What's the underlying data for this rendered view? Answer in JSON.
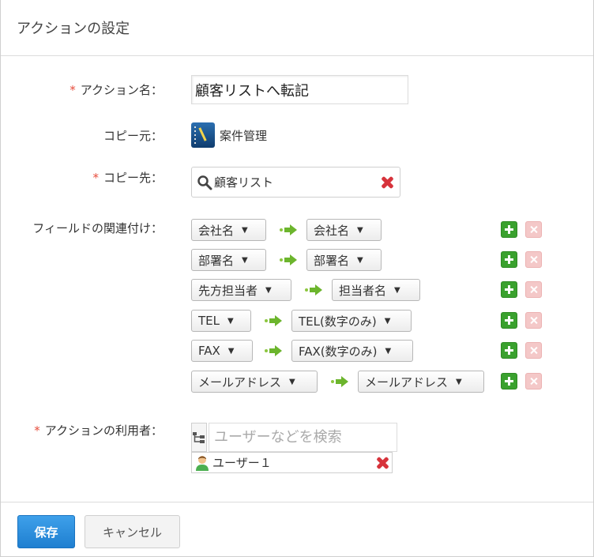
{
  "dialog": {
    "title": "アクションの設定"
  },
  "form": {
    "action_name": {
      "label": "アクション名：",
      "required_mark": "*",
      "value": "顧客リストへ転記"
    },
    "source": {
      "label": "コピー元：",
      "app_name": "案件管理",
      "app_icon": "notebook-app-icon"
    },
    "destination": {
      "label": "コピー先：",
      "required_mark": "*",
      "app_name": "顧客リスト"
    },
    "field_mapping": {
      "label": "フィールドの関連付け：",
      "rows": [
        {
          "from": "会社名",
          "to": "会社名"
        },
        {
          "from": "部署名",
          "to": "部署名"
        },
        {
          "from": "先方担当者",
          "to": "担当者名"
        },
        {
          "from": "TEL",
          "to": "TEL(数字のみ)"
        },
        {
          "from": "FAX",
          "to": "FAX(数字のみ)"
        },
        {
          "from": "メールアドレス",
          "to": "メールアドレス"
        }
      ]
    },
    "users": {
      "label": "アクションの利用者：",
      "required_mark": "*",
      "search_placeholder": "ユーザーなどを検索",
      "selected": [
        {
          "name": "ユーザー１"
        }
      ]
    }
  },
  "footer": {
    "save_label": "保存",
    "cancel_label": "キャンセル"
  },
  "colors": {
    "required": "#e74c3c",
    "save_button": "#2a8ee0",
    "add": "#3aa12e",
    "remove_disabled": "#f4c8c8",
    "remove": "#d7333b"
  }
}
